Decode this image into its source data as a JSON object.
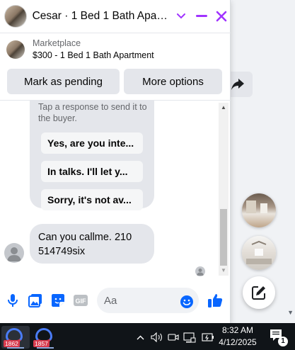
{
  "chat": {
    "title": "Cesar · 1 Bed 1 Bath Apart...",
    "listing_source": "Marketplace",
    "listing_name": "$300 - 1 Bed 1 Bath Apartment",
    "actions": {
      "mark_pending": "Mark as pending",
      "more_options": "More options"
    },
    "bot_hint": "Tap a response to send it to the buyer.",
    "quick_replies": [
      "Yes, are you inte...",
      "In talks. I'll let y...",
      "Sorry, it's not av..."
    ],
    "buyer_message": "Can you callme. 210 514749six",
    "composer_placeholder": "Aa",
    "accent_color": "#a033ff",
    "messenger_blue": "#0866ff"
  },
  "taskbar": {
    "app1_badge": "1862",
    "app2_badge": "1857",
    "time": "8:32 AM",
    "date": "4/12/2025",
    "notification_count": "1"
  }
}
